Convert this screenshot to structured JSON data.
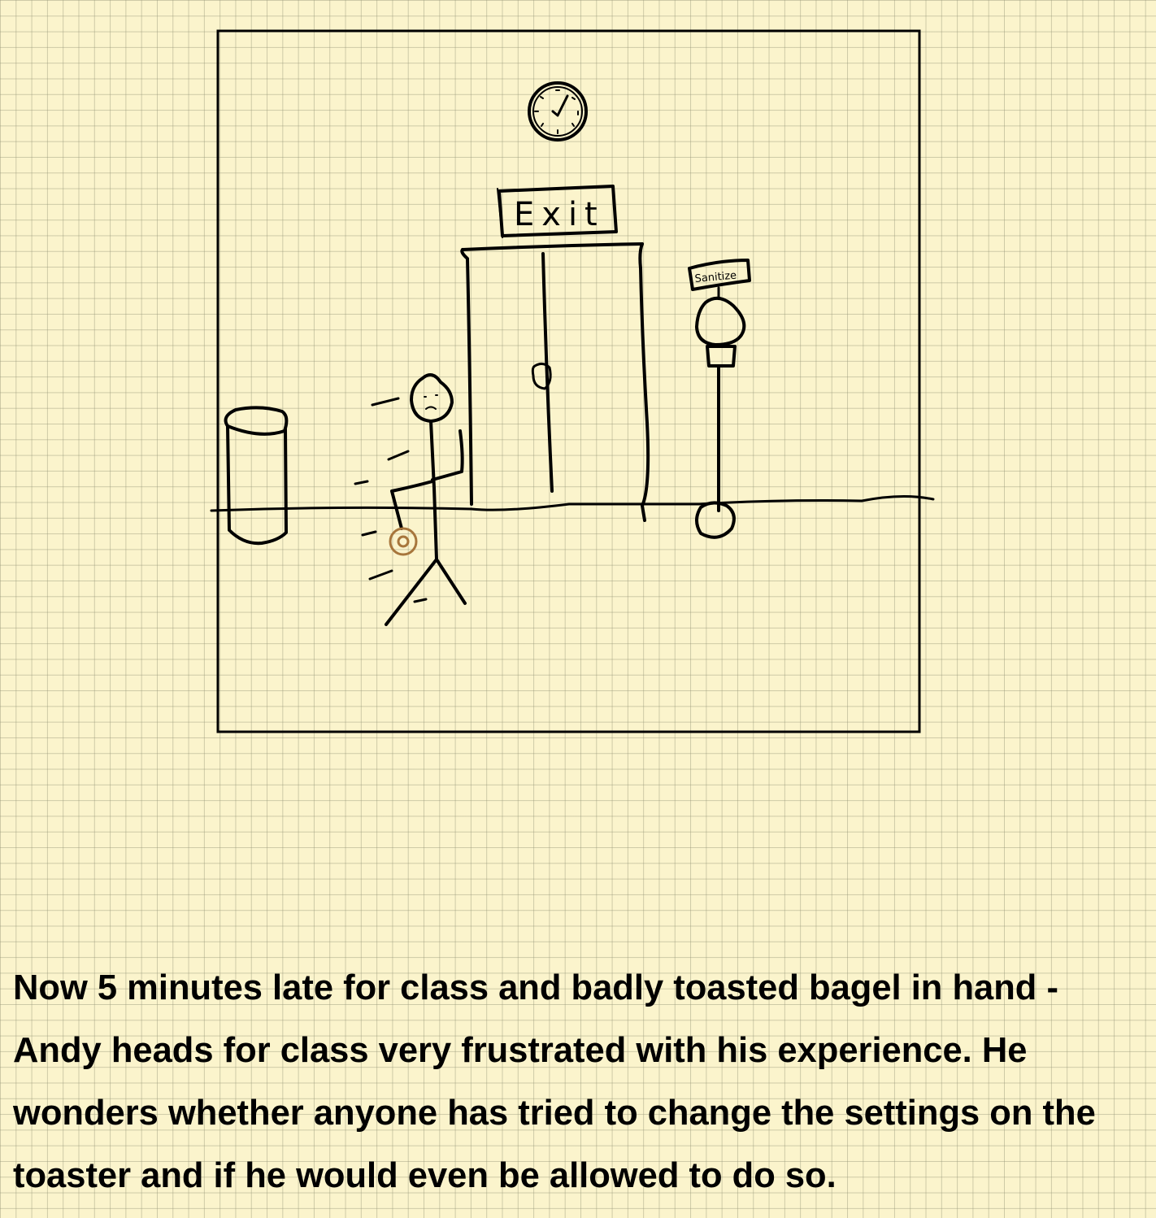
{
  "scene": {
    "exit_sign": "Exit",
    "sanitizer_sign": "Sanitize"
  },
  "caption": "Now 5 minutes late for class and badly toasted bagel in hand - Andy heads for class very frustrated with his experience. He wonders whether anyone has tried to change the settings on the toaster and if he would even be allowed to do so.",
  "colors": {
    "paper": "#fbf4cc",
    "grid": "#a8a88c",
    "ink": "#000000",
    "bagel": "#a7763c"
  }
}
